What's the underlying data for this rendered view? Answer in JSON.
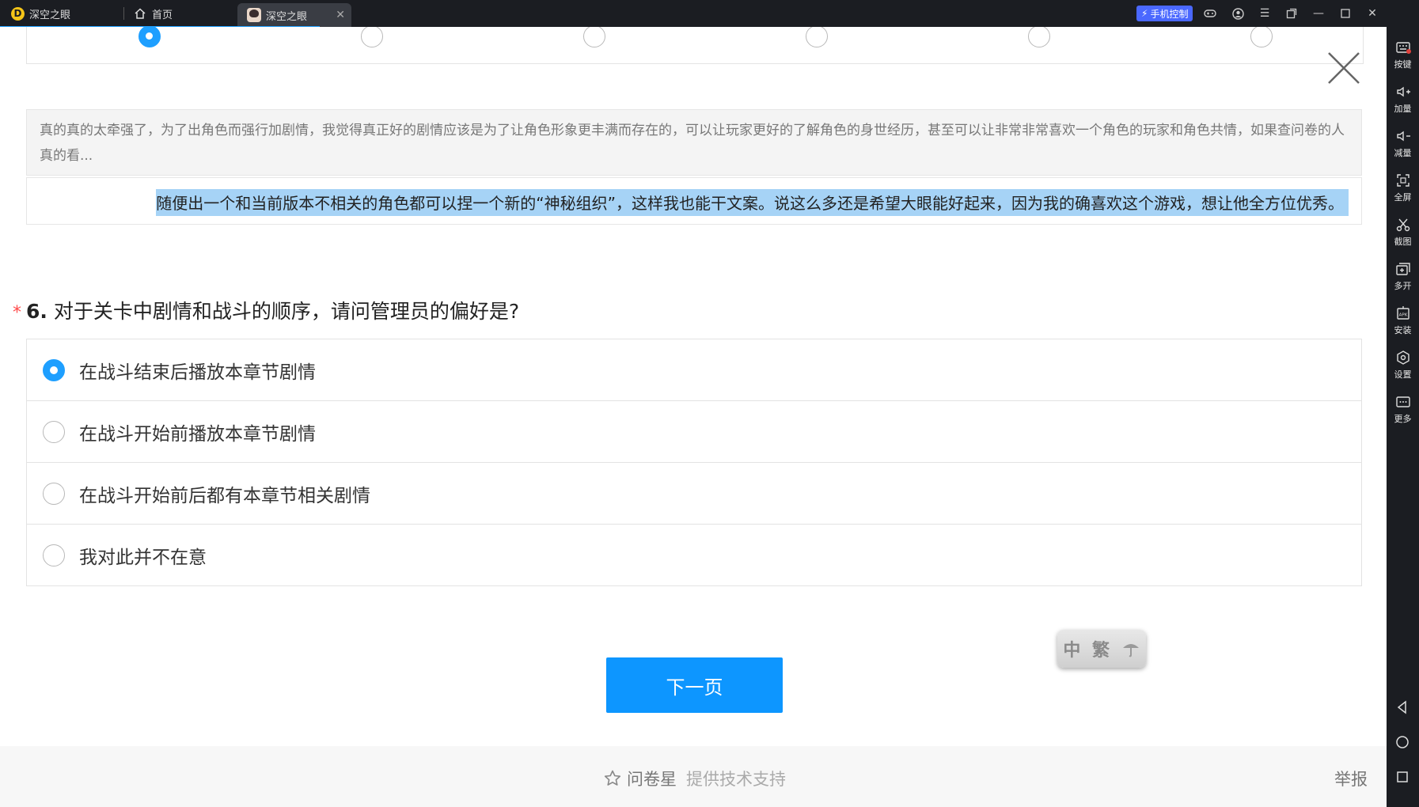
{
  "titlebar": {
    "app_tab": "深空之眼",
    "home_tab": "首页",
    "game_tab": "深空之眼",
    "mobile_control": "手机控制",
    "accent_color": "#1e9fff"
  },
  "sidebar": {
    "items": [
      {
        "label": "按键",
        "icon": "keyboard-icon"
      },
      {
        "label": "加量",
        "icon": "volume-up-icon"
      },
      {
        "label": "减量",
        "icon": "volume-down-icon"
      },
      {
        "label": "全屏",
        "icon": "fullscreen-icon"
      },
      {
        "label": "截图",
        "icon": "scissors-icon"
      },
      {
        "label": "多开",
        "icon": "multi-instance-icon"
      },
      {
        "label": "安装",
        "icon": "apk-install-icon"
      },
      {
        "label": "设置",
        "icon": "settings-icon"
      },
      {
        "label": "更多",
        "icon": "more-icon"
      }
    ]
  },
  "survey": {
    "steps_total": 6,
    "active_step": 1,
    "comment_text": "真的真的太牵强了，为了出角色而强行加剧情，我觉得真正好的剧情应该是为了让角色形象更丰满而存在的，可以让玩家更好的了解角色的身世经历，甚至可以让非常非常喜欢一个角色的玩家和角色共情，如果查问卷的人真的看...",
    "input_text": "随便出一个和当前版本不相关的角色都可以捏一个新的“神秘组织”，这样我也能干文案。说这么多还是希望大眼能好起来，因为我的确喜欢这个游戏，想让他全方位优秀。",
    "question": {
      "required_mark": "*",
      "number": "6.",
      "text": "对于关卡中剧情和战斗的顺序，请问管理员的偏好是?",
      "options": [
        {
          "label": "在战斗结束后播放本章节剧情",
          "checked": true
        },
        {
          "label": "在战斗开始前播放本章节剧情",
          "checked": false
        },
        {
          "label": "在战斗开始前后都有本章节相关剧情",
          "checked": false
        },
        {
          "label": "我对此并不在意",
          "checked": false
        }
      ]
    },
    "next_button": "下一页",
    "lang_widget": {
      "simplified": "中",
      "traditional": "繁",
      "icon": "umbrella-icon"
    }
  },
  "footer": {
    "brand": "问卷星",
    "support": "提供技术支持",
    "report": "举报"
  }
}
